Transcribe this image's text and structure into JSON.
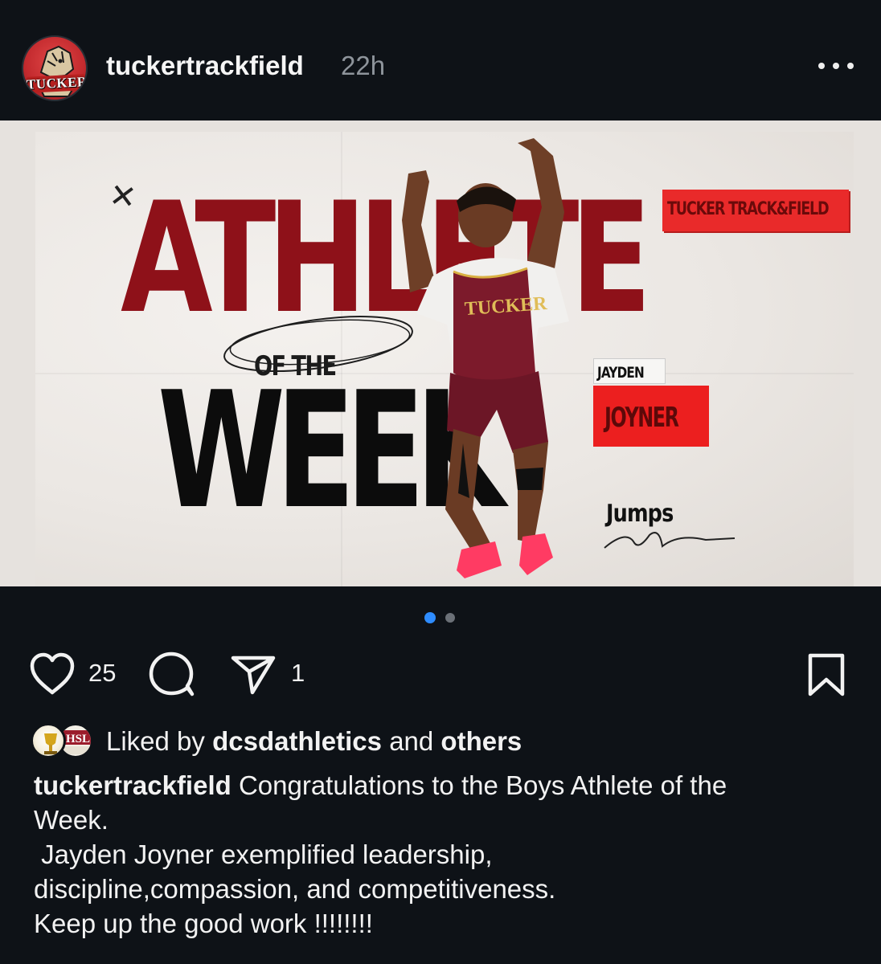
{
  "post": {
    "username": "tuckertrackfield",
    "time_ago": "22h",
    "avatar_text": "TUCKER"
  },
  "poster": {
    "headline_top": "ATHLETE",
    "headline_mid": "OF THE",
    "headline_bottom": "WEEK",
    "team_label": "TUCKER TRACK&FIELD",
    "jersey_text": "TUCKER",
    "first_name": "JAYDEN",
    "last_name": "JOYNER",
    "event": "Jumps"
  },
  "carousel": {
    "current": 1,
    "total": 2
  },
  "actions": {
    "likes": "25",
    "shares": "1"
  },
  "liked_by": {
    "prefix": "Liked by",
    "user": "dcsdathletics",
    "middle": "and",
    "others": "others",
    "liker_badge_text": "HSL"
  },
  "caption": {
    "username": "tuckertrackfield",
    "line1": "Congratulations to the Boys Athlete of the",
    "line2": "Week.",
    "line3": " Jayden Joyner exemplified leadership,",
    "line4": "discipline,compassion, and competitiveness.",
    "line5": "Keep up the good work !!!!!!!!"
  },
  "colors": {
    "background": "#0e1217",
    "accent_blue": "#2e8cff",
    "maroon": "#8e1119",
    "red_label": "#e92a2a"
  }
}
